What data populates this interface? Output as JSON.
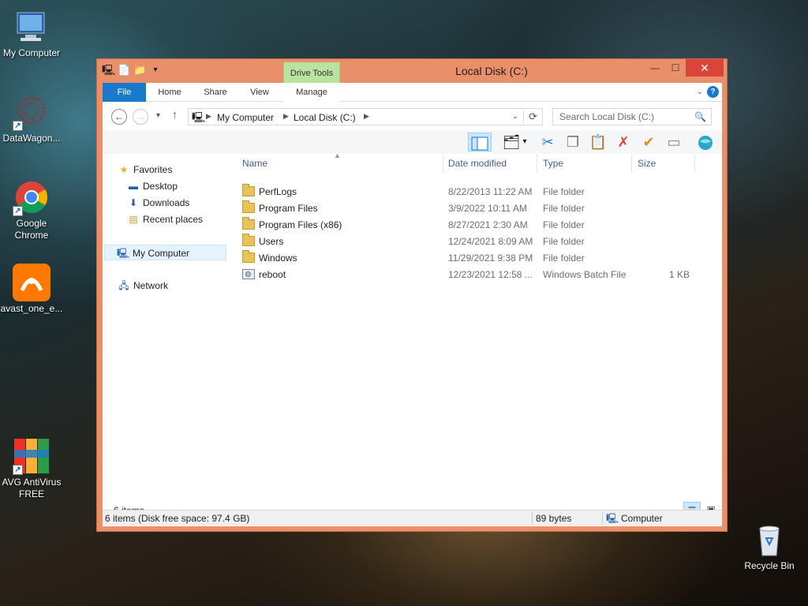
{
  "desktop": {
    "icons": [
      {
        "label": "My Computer",
        "icon": "computer-icon"
      },
      {
        "label": "DataWagon...",
        "icon": "datawagon-icon"
      },
      {
        "label": "Google Chrome",
        "icon": "chrome-icon"
      },
      {
        "label": "avast_one_e...",
        "icon": "avast-icon"
      },
      {
        "label": "AVG AntiVirus FREE",
        "icon": "avg-icon"
      },
      {
        "label": "Recycle Bin",
        "icon": "recycle-bin-icon"
      }
    ]
  },
  "window": {
    "title": "Local Disk (C:)",
    "controls": {
      "minimize": "—",
      "maximize": "☐",
      "close": "✕"
    },
    "context_tab": "Drive Tools",
    "tabs": [
      "File",
      "Home",
      "Share",
      "View",
      "Manage"
    ],
    "help": "?",
    "address": {
      "segments": [
        "My Computer",
        "Local Disk (C:)"
      ]
    },
    "search": {
      "placeholder": "Search Local Disk (C:)"
    },
    "nav_pane": {
      "favorites": "Favorites",
      "favorite_items": [
        "Desktop",
        "Downloads",
        "Recent places"
      ],
      "computer": "My Computer",
      "network": "Network"
    },
    "columns": [
      "Name",
      "Date modified",
      "Type",
      "Size"
    ],
    "files": [
      {
        "name": "PerfLogs",
        "date": "8/22/2013 11:22 AM",
        "type": "File folder",
        "size": "",
        "kind": "folder"
      },
      {
        "name": "Program Files",
        "date": "3/9/2022 10:11 AM",
        "type": "File folder",
        "size": "",
        "kind": "folder"
      },
      {
        "name": "Program Files (x86)",
        "date": "8/27/2021 2:30 AM",
        "type": "File folder",
        "size": "",
        "kind": "folder"
      },
      {
        "name": "Users",
        "date": "12/24/2021 8:09 AM",
        "type": "File folder",
        "size": "",
        "kind": "folder"
      },
      {
        "name": "Windows",
        "date": "11/29/2021 9:38 PM",
        "type": "File folder",
        "size": "",
        "kind": "folder"
      },
      {
        "name": "reboot",
        "date": "12/23/2021 12:58 ...",
        "type": "Windows Batch File",
        "size": "1 KB",
        "kind": "batch"
      }
    ],
    "item_count": "6 items",
    "status": {
      "summary": "6 items (Disk free space: 97.4 GB)",
      "size": "89 bytes",
      "location": "Computer"
    }
  },
  "colors": {
    "window_frame": "#e9906a",
    "file_tab": "#1979ca",
    "close_button": "#d9453b",
    "context_tab": "#b9e3a0"
  }
}
